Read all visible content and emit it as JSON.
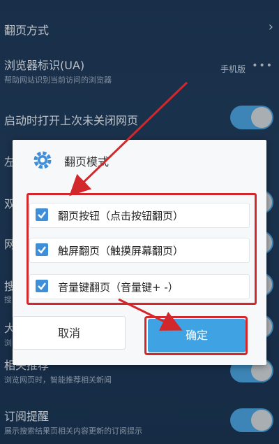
{
  "settings": {
    "page_mode": {
      "title": "翻页方式"
    },
    "ua": {
      "title": "浏览器标识(UA)",
      "sub": "帮助网站识别当前访问的浏览器",
      "value": "手机版",
      "more": "•••"
    },
    "restore": {
      "title": "启动时打开上次未关闭网页"
    },
    "partial_left_a": "左",
    "partial_left_b": "双",
    "partial_left_c": "网",
    "partial_left_d": "搜",
    "partial_left_d_sub": "搜",
    "partial_left_e": "大",
    "partial_left_e_sub": "浏",
    "recommend": {
      "title": "相关推荐",
      "sub": "浏览网页时，智能推荐相关新闻"
    },
    "subscribe": {
      "title": "订阅提醒",
      "sub": "展示搜索结果页相关内容更新的订阅提示"
    }
  },
  "dialog": {
    "title": "翻页模式",
    "options": [
      {
        "label": "翻页按钮（点击按钮翻页）",
        "checked": true
      },
      {
        "label": "触屏翻页（触摸屏幕翻页）",
        "checked": true
      },
      {
        "label": "音量键翻页（音量键+ -）",
        "checked": true
      }
    ],
    "cancel": "取消",
    "confirm": "确定"
  },
  "colors": {
    "accent": "#3fa2e2",
    "highlight": "#d2272b",
    "background": "#1f3a5a"
  }
}
